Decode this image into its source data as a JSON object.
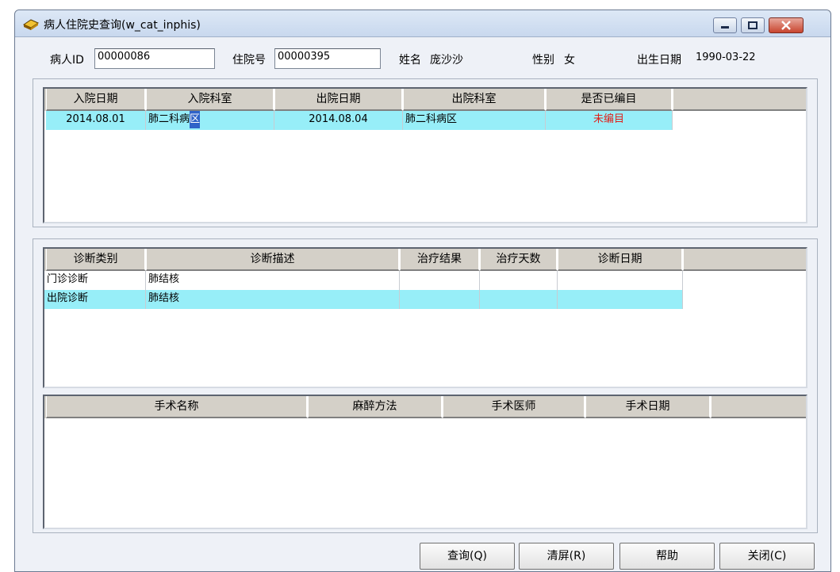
{
  "window": {
    "title": "病人住院史查询(w_cat_inphis)"
  },
  "patient": {
    "id_label": "病人ID",
    "id_value": "00000086",
    "admission_no_label": "住院号",
    "admission_no_value": "00000395",
    "name_label": "姓名",
    "name_value": "庞沙沙",
    "sex_label": "性别",
    "sex_value": "女",
    "birth_label": "出生日期",
    "birth_value": "1990-03-22"
  },
  "admissions": {
    "columns": [
      "入院日期",
      "入院科室",
      "出院日期",
      "出院科室",
      "是否已编目"
    ],
    "rows": [
      {
        "admit_date": "2014.08.01",
        "admit_dept": "肺二科病",
        "admit_dept_cursor": "区",
        "discharge_date": "2014.08.04",
        "discharge_dept": "肺二科病区",
        "coded": "未编目"
      }
    ]
  },
  "diagnoses": {
    "columns": [
      "诊断类别",
      "诊断描述",
      "治疗结果",
      "治疗天数",
      "诊断日期"
    ],
    "rows": [
      {
        "type": "门诊诊断",
        "desc": "肺结核",
        "result": "",
        "days": "",
        "date": ""
      },
      {
        "type": "出院诊断",
        "desc": "肺结核",
        "result": "",
        "days": "",
        "date": ""
      }
    ]
  },
  "surgeries": {
    "columns": [
      "手术名称",
      "麻醉方法",
      "手术医师",
      "手术日期"
    ]
  },
  "buttons": {
    "query": "查询(Q)",
    "clear": "清屏(R)",
    "help": "帮助",
    "close": "关闭(C)"
  },
  "colors": {
    "selected_row": "#97eef8",
    "not_coded_text": "#e0201a"
  }
}
